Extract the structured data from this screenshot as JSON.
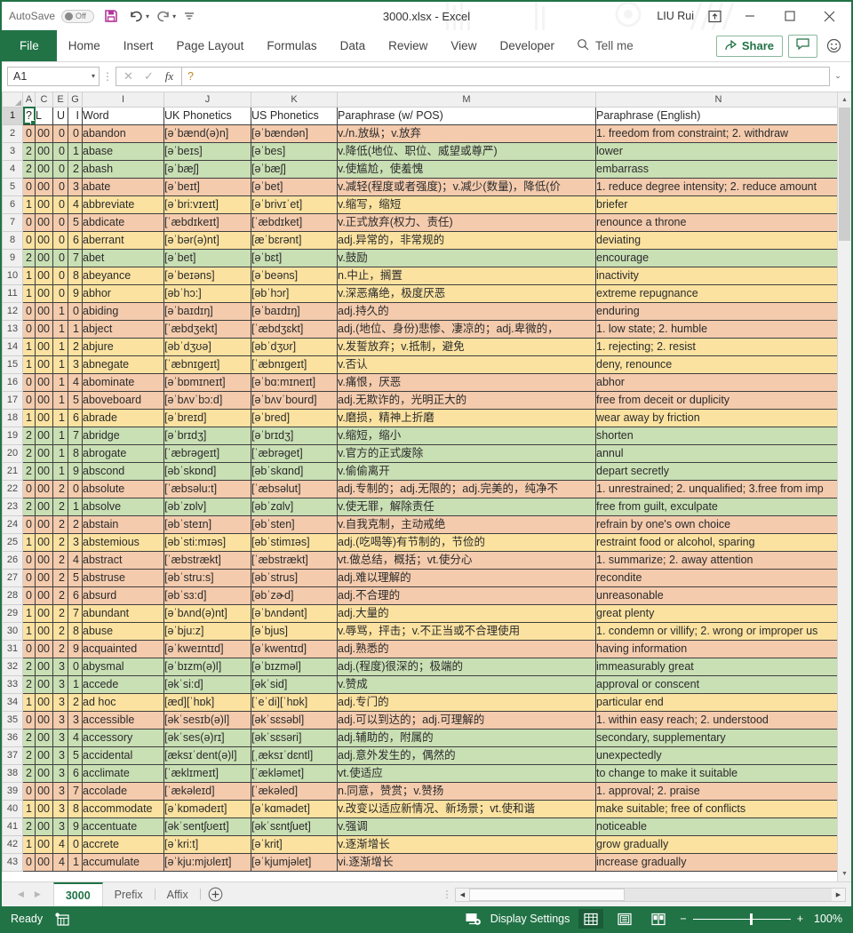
{
  "titlebar": {
    "autosave_label": "AutoSave",
    "autosave_state": "Off",
    "save_icon": "save-icon",
    "undo_icon": "undo-icon",
    "redo_icon": "redo-icon",
    "customize_icon": "customize-quick-access-icon",
    "document_title": "3000.xlsx  -  Excel",
    "user_name": "LIU Rui",
    "ribbon_display_icon": "ribbon-display-options-icon",
    "minimize_icon": "minimize-icon",
    "maximize_icon": "maximize-icon",
    "close_icon": "close-icon"
  },
  "ribbon": {
    "tabs": [
      {
        "label": "File"
      },
      {
        "label": "Home"
      },
      {
        "label": "Insert"
      },
      {
        "label": "Page Layout"
      },
      {
        "label": "Formulas"
      },
      {
        "label": "Data"
      },
      {
        "label": "Review"
      },
      {
        "label": "View"
      },
      {
        "label": "Developer"
      }
    ],
    "tellme_label": "Tell me",
    "tellme_icon": "search-icon",
    "share_label": "Share",
    "share_icon": "share-icon",
    "comment_icon": "comment-icon",
    "smiley_icon": "smiley-feedback-icon"
  },
  "formulabar": {
    "name_box_value": "A1",
    "cancel_icon": "cancel-icon",
    "enter_icon": "confirm-icon",
    "function_icon": "insert-function-icon",
    "formula_value": "?",
    "expand_icon": "chevron-down-icon"
  },
  "grid": {
    "column_letters": [
      "A",
      "C",
      "E",
      "G",
      "I",
      "J",
      "K",
      "M",
      "N"
    ],
    "headers": [
      "?",
      "L",
      "U",
      "I",
      "Word",
      "UK Phonetics",
      "US Phonetics",
      "Paraphrase (w/ POS)",
      "Paraphrase (English)"
    ],
    "selected_cell": "A1",
    "rows": [
      {
        "n": 2,
        "fill": "f-orange",
        "c": [
          "0",
          "00",
          "0",
          "0",
          "abandon",
          "[əˈbænd(ə)n]",
          "[əˈbændən]",
          "v./n.放纵；v.放弃",
          "1. freedom from constraint; 2. withdraw"
        ]
      },
      {
        "n": 3,
        "fill": "f-green",
        "c": [
          "2",
          "00",
          "0",
          "1",
          "abase",
          "[əˈbeɪs]",
          "[əˈbes]",
          "v.降低(地位、职位、威望或尊严)",
          "lower"
        ]
      },
      {
        "n": 4,
        "fill": "f-green",
        "c": [
          "2",
          "00",
          "0",
          "2",
          "abash",
          "[əˈbæʃ]",
          "[əˈbæʃ]",
          "v.使尴尬，使羞愧",
          "embarrass"
        ]
      },
      {
        "n": 5,
        "fill": "f-orange",
        "c": [
          "0",
          "00",
          "0",
          "3",
          "abate",
          "[əˈbeɪt]",
          "[əˈbet]",
          "v.减轻(程度或者强度)；v.减少(数量)，降低(价",
          "1. reduce degree intensity; 2. reduce amount"
        ]
      },
      {
        "n": 6,
        "fill": "f-yellow",
        "c": [
          "1",
          "00",
          "0",
          "4",
          "abbreviate",
          "[əˈbri:vɪeɪt]",
          "[əˈbrivɪˈet]",
          "v.缩写，缩短",
          "briefer"
        ]
      },
      {
        "n": 7,
        "fill": "f-orange",
        "c": [
          "0",
          "00",
          "0",
          "5",
          "abdicate",
          "[ˈæbdɪkeɪt]",
          "[ˈæbdɪket]",
          "v.正式放弃(权力、责任)",
          "renounce a throne"
        ]
      },
      {
        "n": 8,
        "fill": "f-yellow",
        "c": [
          "0",
          "00",
          "0",
          "6",
          "aberrant",
          "[əˈbər(ə)nt]",
          "[æˈbɛrənt]",
          "adj.异常的，非常规的",
          "deviating"
        ]
      },
      {
        "n": 9,
        "fill": "f-green",
        "c": [
          "2",
          "00",
          "0",
          "7",
          "abet",
          "[əˈbet]",
          "[əˈbɛt]",
          "v.鼓励",
          "encourage"
        ]
      },
      {
        "n": 10,
        "fill": "f-yellow",
        "c": [
          "1",
          "00",
          "0",
          "8",
          "abeyance",
          "[əˈbeɪəns]",
          "[əˈbeəns]",
          "n.中止，搁置",
          "inactivity"
        ]
      },
      {
        "n": 11,
        "fill": "f-yellow",
        "c": [
          "1",
          "00",
          "0",
          "9",
          "abhor",
          "[əbˈhɔ:]",
          "[əbˈhɔr]",
          "v.深恶痛绝，极度厌恶",
          "extreme repugnance"
        ]
      },
      {
        "n": 12,
        "fill": "f-orange",
        "c": [
          "0",
          "00",
          "1",
          "0",
          "abiding",
          "[əˈbaɪdɪŋ]",
          "[əˈbaɪdɪŋ]",
          "adj.持久的",
          "enduring"
        ]
      },
      {
        "n": 13,
        "fill": "f-orange",
        "c": [
          "0",
          "00",
          "1",
          "1",
          "abject",
          "[ˈæbdʒekt]",
          "[ˈæbdʒɛkt]",
          "adj.(地位、身份)悲惨、凄凉的；adj.卑微的，",
          "1. low state; 2. humble"
        ]
      },
      {
        "n": 14,
        "fill": "f-yellow",
        "c": [
          "1",
          "00",
          "1",
          "2",
          "abjure",
          "[əbˈdʒʊə]",
          "[əbˈdʒʊr]",
          "v.发誓放弃；v.抵制，避免",
          "1. rejecting; 2. resist"
        ]
      },
      {
        "n": 15,
        "fill": "f-yellow",
        "c": [
          "1",
          "00",
          "1",
          "3",
          "abnegate",
          "[ˈæbnɪgeɪt]",
          "[ˈæbnɪgeɪt]",
          "v.否认",
          "deny, renounce"
        ]
      },
      {
        "n": 16,
        "fill": "f-orange",
        "c": [
          "0",
          "00",
          "1",
          "4",
          "abominate",
          "[əˈbɒmɪneɪt]",
          "[əˈbɑ:mɪneɪt]",
          "v.痛恨，厌恶",
          "abhor"
        ]
      },
      {
        "n": 17,
        "fill": "f-orange",
        "c": [
          "0",
          "00",
          "1",
          "5",
          "aboveboard",
          "[əˈbʌvˈbɔ:d]",
          "[əˈbʌvˈbourd]",
          "adj.无欺诈的，光明正大的",
          "free from deceit or duplicity"
        ]
      },
      {
        "n": 18,
        "fill": "f-yellow",
        "c": [
          "1",
          "00",
          "1",
          "6",
          "abrade",
          "[əˈbreɪd]",
          "[əˈbred]",
          "v.磨损，精神上折磨",
          "wear away by friction"
        ]
      },
      {
        "n": 19,
        "fill": "f-green",
        "c": [
          "2",
          "00",
          "1",
          "7",
          "abridge",
          "[əˈbrɪdʒ]",
          "[əˈbrɪdʒ]",
          "v.缩短，缩小",
          "shorten"
        ]
      },
      {
        "n": 20,
        "fill": "f-green",
        "c": [
          "2",
          "00",
          "1",
          "8",
          "abrogate",
          "[ˈæbrəgeɪt]",
          "[ˈæbrəget]",
          "v.官方的正式废除",
          "annul"
        ]
      },
      {
        "n": 21,
        "fill": "f-green",
        "c": [
          "2",
          "00",
          "1",
          "9",
          "abscond",
          "[əbˈskɒnd]",
          "[əbˈskɑnd]",
          "v.偷偷离开",
          "depart secretly"
        ]
      },
      {
        "n": 22,
        "fill": "f-orange",
        "c": [
          "0",
          "00",
          "2",
          "0",
          "absolute",
          "[ˈæbsəlu:t]",
          "[ˈæbsəlut]",
          "adj.专制的；adj.无限的；adj.完美的，纯净不",
          "1. unrestrained; 2. unqualified; 3.free from imp"
        ]
      },
      {
        "n": 23,
        "fill": "f-green",
        "c": [
          "2",
          "00",
          "2",
          "1",
          "absolve",
          "[əbˈzɒlv]",
          "[əbˈzɑlv]",
          "v.使无罪，解除责任",
          "free from guilt, exculpate"
        ]
      },
      {
        "n": 24,
        "fill": "f-orange",
        "c": [
          "0",
          "00",
          "2",
          "2",
          "abstain",
          "[əbˈsteɪn]",
          "[əbˈsten]",
          "v.自我克制，主动戒绝",
          "refrain by one's own choice"
        ]
      },
      {
        "n": 25,
        "fill": "f-yellow",
        "c": [
          "1",
          "00",
          "2",
          "3",
          "abstemious",
          "[əbˈsti:mɪəs]",
          "[əbˈstimɪəs]",
          "adj.(吃喝等)有节制的，节俭的",
          "restraint food or alcohol, sparing"
        ]
      },
      {
        "n": 26,
        "fill": "f-orange",
        "c": [
          "0",
          "00",
          "2",
          "4",
          "abstract",
          "[ˈæbstrækt]",
          "[ˈæbstrækt]",
          "vt.做总结，概括；vt.使分心",
          "1. summarize; 2. away attention"
        ]
      },
      {
        "n": 27,
        "fill": "f-orange",
        "c": [
          "0",
          "00",
          "2",
          "5",
          "abstruse",
          "[əbˈstru:s]",
          "[əbˈstrus]",
          "adj.难以理解的",
          "recondite"
        ]
      },
      {
        "n": 28,
        "fill": "f-orange",
        "c": [
          "0",
          "00",
          "2",
          "6",
          "absurd",
          "[əbˈsɜ:d]",
          "[əbˈzɚd]",
          "adj.不合理的",
          "unreasonable"
        ]
      },
      {
        "n": 29,
        "fill": "f-yellow",
        "c": [
          "1",
          "00",
          "2",
          "7",
          "abundant",
          "[əˈbʌnd(ə)nt]",
          "[əˈbʌndənt]",
          "adj.大量的",
          "great plenty"
        ]
      },
      {
        "n": 30,
        "fill": "f-yellow",
        "c": [
          "1",
          "00",
          "2",
          "8",
          "abuse",
          "[əˈbju:z]",
          "[əˈbjus]",
          "v.辱骂，抨击；v.不正当或不合理使用",
          "1. condemn or villify; 2. wrong or improper us"
        ]
      },
      {
        "n": 31,
        "fill": "f-orange",
        "c": [
          "0",
          "00",
          "2",
          "9",
          "acquainted",
          "[əˈkweɪntɪd]",
          "[əˈkwentɪd]",
          "adj.熟悉的",
          "having information"
        ]
      },
      {
        "n": 32,
        "fill": "f-green",
        "c": [
          "2",
          "00",
          "3",
          "0",
          "abysmal",
          "[əˈbɪzm(ə)l]",
          "[əˈbɪzməl]",
          "adj.(程度)很深的；极端的",
          "immeasurably great"
        ]
      },
      {
        "n": 33,
        "fill": "f-green",
        "c": [
          "2",
          "00",
          "3",
          "1",
          "accede",
          "[əkˈsi:d]",
          "[əkˈsid]",
          "v.赞成",
          "approval or conscent"
        ]
      },
      {
        "n": 34,
        "fill": "f-yellow",
        "c": [
          "1",
          "00",
          "3",
          "2",
          "ad hoc",
          "[æd][ˈhɒk]",
          "[ˈeˈdi][ˈhɒk]",
          "adj.专门的",
          "particular end"
        ]
      },
      {
        "n": 35,
        "fill": "f-orange",
        "c": [
          "0",
          "00",
          "3",
          "3",
          "accessible",
          "[əkˈsesɪb(ə)l]",
          "[əkˈsɛsəbl]",
          "adj.可以到达的；adj.可理解的",
          "1. within easy reach; 2. understood"
        ]
      },
      {
        "n": 36,
        "fill": "f-green",
        "c": [
          "2",
          "00",
          "3",
          "4",
          "accessory",
          "[əkˈses(ə)rɪ]",
          "[əkˈsɛsəri]",
          "adj.辅助的，附属的",
          "secondary, supplementary"
        ]
      },
      {
        "n": 37,
        "fill": "f-green",
        "c": [
          "2",
          "00",
          "3",
          "5",
          "accidental",
          "[æksɪˈdent(ə)l]",
          "[ˌæksɪˈdɛntl]",
          "adj.意外发生的，偶然的",
          "unexpectedly"
        ]
      },
      {
        "n": 38,
        "fill": "f-green",
        "c": [
          "2",
          "00",
          "3",
          "6",
          "acclimate",
          "[ˈæklɪmeɪt]",
          "[ˈækləmet]",
          "vt.使适应",
          "to change to make it suitable"
        ]
      },
      {
        "n": 39,
        "fill": "f-orange",
        "c": [
          "0",
          "00",
          "3",
          "7",
          "accolade",
          "[ˈækəleɪd]",
          "[ˈækəled]",
          "n.同意，赞赏；v.赞扬",
          "1. approval; 2. praise"
        ]
      },
      {
        "n": 40,
        "fill": "f-yellow",
        "c": [
          "1",
          "00",
          "3",
          "8",
          "accommodate",
          "[əˈkɒmədeɪt]",
          "[əˈkɑmədet]",
          "v.改变以适应新情况、新场景；vt.使和谐",
          "make suitable; free of conflicts"
        ]
      },
      {
        "n": 41,
        "fill": "f-green",
        "c": [
          "2",
          "00",
          "3",
          "9",
          "accentuate",
          "[əkˈsentʃʊeɪt]",
          "[əkˈsɛntʃuet]",
          "v.强调",
          "noticeable"
        ]
      },
      {
        "n": 42,
        "fill": "f-yellow",
        "c": [
          "1",
          "00",
          "4",
          "0",
          "accrete",
          "[əˈkri:t]",
          "[əˈkrit]",
          "v.逐渐增长",
          "grow gradually"
        ]
      },
      {
        "n": 43,
        "fill": "f-orange",
        "c": [
          "0",
          "00",
          "4",
          "1",
          "accumulate",
          "[əˈkju:mjʊleɪt]",
          "[əˈkjumjəlet]",
          "vi.逐渐增长",
          "increase gradually"
        ]
      }
    ]
  },
  "sheettabs": {
    "prev_icon": "previous-sheet-icon",
    "next_icon": "next-sheet-icon",
    "tabs": [
      {
        "label": "3000",
        "active": true
      },
      {
        "label": "Prefix",
        "active": false
      },
      {
        "label": "Affix",
        "active": false
      }
    ],
    "add_label": "+",
    "add_icon": "new-sheet-icon"
  },
  "statusbar": {
    "status_text": "Ready",
    "macro_icon": "record-macro-icon",
    "display_settings_label": "Display Settings",
    "display_settings_icon": "display-settings-icon",
    "normal_view_icon": "normal-view-icon",
    "page_layout_icon": "page-layout-view-icon",
    "page_break_icon": "page-break-preview-icon",
    "zoom_out_label": "−",
    "zoom_in_label": "+",
    "zoom_level": "100%"
  },
  "colors": {
    "accent": "#217346",
    "fill_orange": "#f4cbad",
    "fill_green": "#c9dfb4",
    "fill_yellow": "#fbe2a0"
  }
}
